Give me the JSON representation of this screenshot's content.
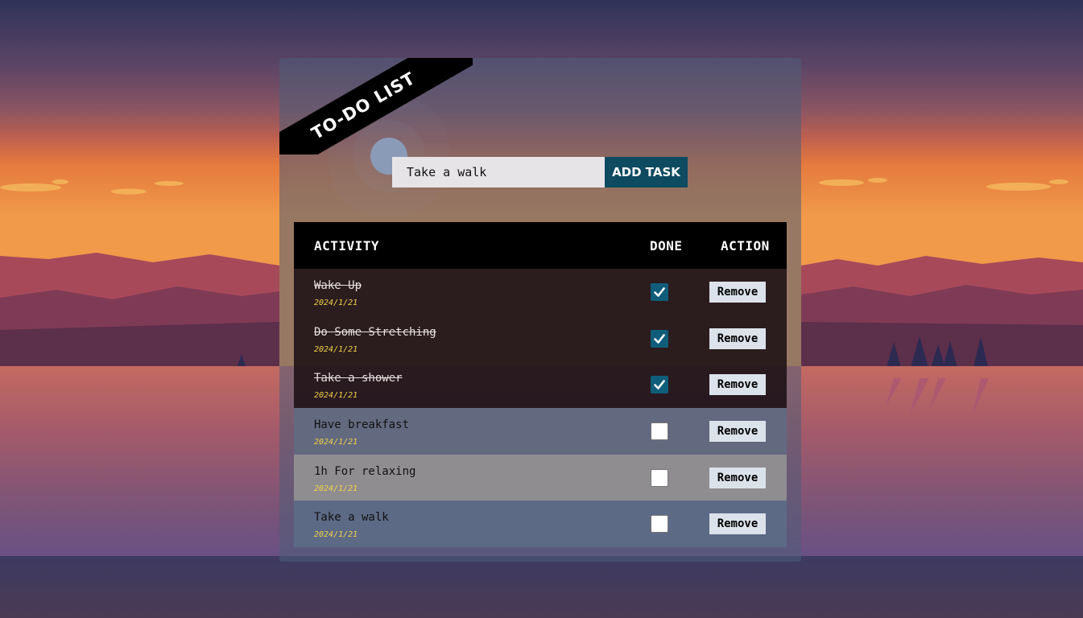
{
  "banner": {
    "title": "TO-DO LIST"
  },
  "new_task": {
    "value": "Take a walk",
    "button_label": "ADD TASK"
  },
  "table": {
    "headers": {
      "activity": "ACTIVITY",
      "done": "DONE",
      "action": "ACTION"
    },
    "rows": [
      {
        "title": "Wake Up",
        "date": "2024/1/21",
        "done": true,
        "remove_label": "Remove"
      },
      {
        "title": "Do Some Stretching",
        "date": "2024/1/21",
        "done": true,
        "remove_label": "Remove"
      },
      {
        "title": "Take a shower",
        "date": "2024/1/21",
        "done": true,
        "remove_label": "Remove"
      },
      {
        "title": "Have breakfast",
        "date": "2024/1/21",
        "done": false,
        "remove_label": "Remove"
      },
      {
        "title": "1h For relaxing",
        "date": "2024/1/21",
        "done": false,
        "remove_label": "Remove"
      },
      {
        "title": "Take a walk",
        "date": "2024/1/21",
        "done": false,
        "remove_label": "Remove"
      }
    ]
  },
  "colors": {
    "accent": "#0e4a60",
    "checkbox_checked": "#0f5d7a",
    "date_text": "#f2d348",
    "header_bg": "#000000"
  },
  "icons": {
    "check": "checkmark-icon"
  }
}
